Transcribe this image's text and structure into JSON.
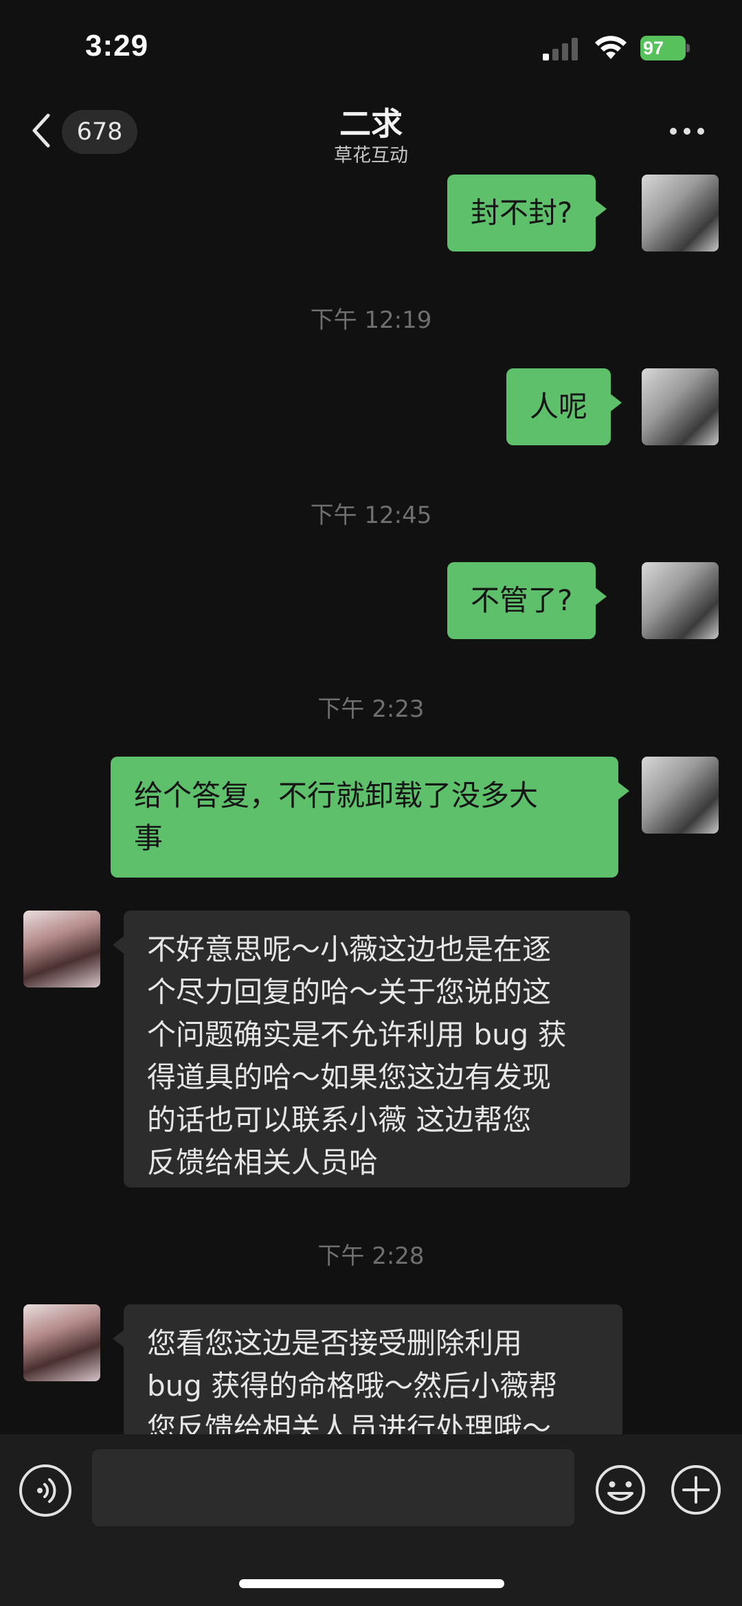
{
  "status_bar": {
    "time": "3:29",
    "battery": "97"
  },
  "nav": {
    "unread_count": "678",
    "title": "二求",
    "subtitle": "草花互动"
  },
  "messages": [
    {
      "type": "out",
      "text": "封不封?"
    },
    {
      "type": "time",
      "text": "下午 12:19"
    },
    {
      "type": "out",
      "text": "人呢"
    },
    {
      "type": "time",
      "text": "下午 12:45"
    },
    {
      "type": "out",
      "text": "不管了?"
    },
    {
      "type": "time",
      "text": "下午 2:23"
    },
    {
      "type": "out",
      "lines": [
        "给个答复，不行就卸载了没多大",
        "事"
      ]
    },
    {
      "type": "in",
      "lines": [
        "不好意思呢～小薇这边也是在逐",
        "个尽力回复的哈～关于您说的这",
        "个问题确实是不允许利用 bug 获",
        "得道具的哈～如果您这边有发现",
        "的话也可以联系小薇  这边帮您",
        "反馈给相关人员哈"
      ]
    },
    {
      "type": "time",
      "text": "下午 2:28"
    },
    {
      "type": "in",
      "lines": [
        "您看您这边是否接受删除利用",
        "bug 获得的命格哦～然后小薇帮",
        "您反馈给相关人员进行处理哦～"
      ]
    }
  ],
  "input_bar": {
    "placeholder": ""
  },
  "icons": {
    "back": "chevron-left-icon",
    "more": "more-dots-icon",
    "voice": "voice-icon",
    "emoji": "emoji-icon",
    "plus": "plus-icon"
  },
  "colors": {
    "outgoing_bubble": "#5ec06b",
    "incoming_bubble": "#2c2c2c",
    "background": "#111111"
  }
}
